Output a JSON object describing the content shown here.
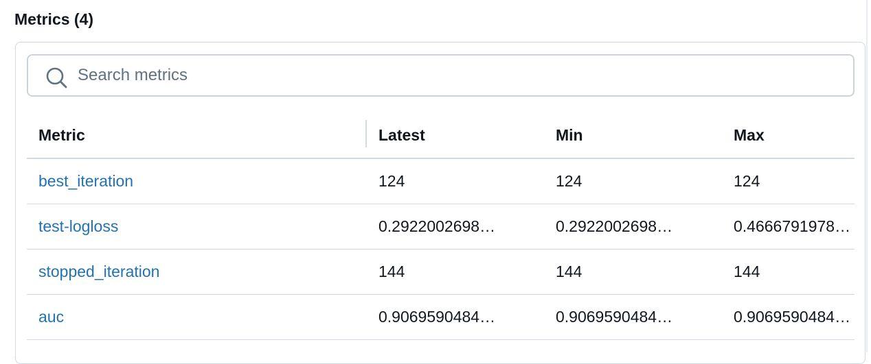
{
  "section": {
    "title": "Metrics (4)"
  },
  "search": {
    "placeholder": "Search metrics",
    "value": ""
  },
  "table": {
    "headers": {
      "metric": "Metric",
      "latest": "Latest",
      "min": "Min",
      "max": "Max"
    },
    "rows": [
      {
        "metric": "best_iteration",
        "latest": "124",
        "min": "124",
        "max": "124"
      },
      {
        "metric": "test-logloss",
        "latest": "0.2922002698…",
        "min": "0.2922002698…",
        "max": "0.4666791978…"
      },
      {
        "metric": "stopped_iteration",
        "latest": "144",
        "min": "144",
        "max": "144"
      },
      {
        "metric": "auc",
        "latest": "0.9069590484…",
        "min": "0.9069590484…",
        "max": "0.9069590484…"
      }
    ]
  },
  "colors": {
    "link": "#2272b4",
    "border": "#d1d9e1",
    "text": "#11171c",
    "placeholder": "#5f7281"
  },
  "icons": {
    "search": "search-icon"
  }
}
